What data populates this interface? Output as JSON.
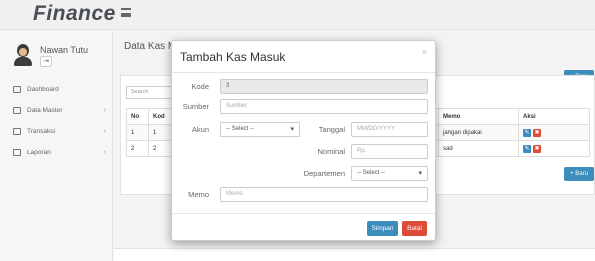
{
  "app": {
    "brand": "Finance"
  },
  "user": {
    "name": "Nawan Tutu",
    "logout_icon": "logout-icon"
  },
  "sidebar": {
    "items": [
      {
        "label": "Dashboard",
        "icon": "dashboard-icon",
        "caret": ""
      },
      {
        "label": "Data Master",
        "icon": "database-icon",
        "caret": "›"
      },
      {
        "label": "Transaksi",
        "icon": "transaction-icon",
        "caret": "›"
      },
      {
        "label": "Laporan",
        "icon": "report-icon",
        "caret": "›"
      }
    ]
  },
  "page": {
    "title": "Data Kas M",
    "search_placeholder": "Search",
    "add_label": "+ Baru",
    "add_label_bottom": "+ Baru"
  },
  "table": {
    "headers": [
      "No",
      "Kod",
      "Memo",
      "Aksi"
    ],
    "rows": [
      {
        "no": "1",
        "kode": "1",
        "memo": "jangan dipakai"
      },
      {
        "no": "2",
        "kode": "2",
        "memo": "sad"
      }
    ]
  },
  "modal": {
    "title": "Tambah Kas Masuk",
    "close": "×",
    "kode_label": "Kode",
    "kode_value": "3",
    "sumber_label": "Sumber",
    "sumber_placeholder": "Sumber",
    "akun_label": "Akun",
    "akun_value": "-- Select --",
    "tanggal_label": "Tanggal",
    "tanggal_placeholder": "MM/DD/YYYY",
    "nominal_label": "Nominal",
    "nominal_placeholder": "Rp.",
    "departemen_label": "Departemen",
    "departemen_value": "-- Select --",
    "memo_label": "Memo",
    "memo_placeholder": "Memo",
    "save_label": "Simpan",
    "cancel_label": "Batal"
  },
  "colors": {
    "primary": "#3c8dbc",
    "danger": "#dd4b39"
  }
}
